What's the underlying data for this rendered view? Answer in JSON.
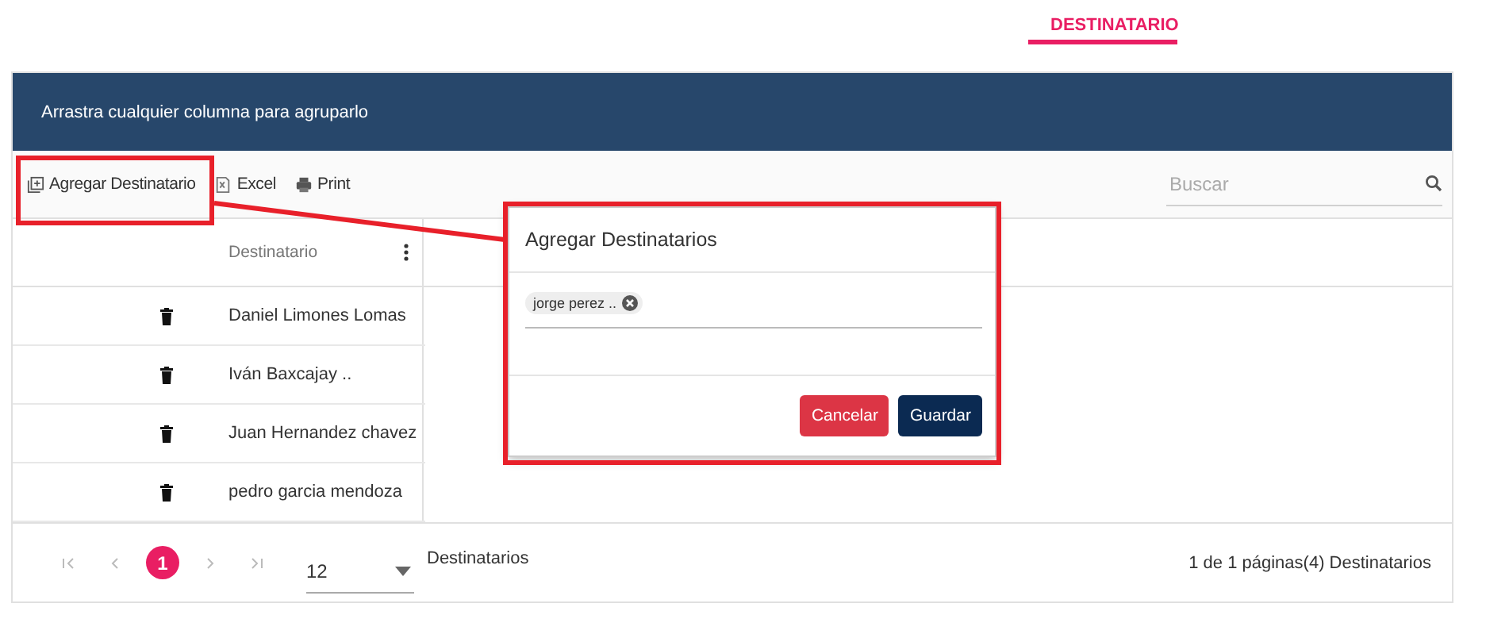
{
  "tabs": [
    {
      "label": "DESTINATARIO",
      "selected": true
    }
  ],
  "grid": {
    "group_panel": "Arrastra cualquier columna para agruparlo",
    "toolbar": [
      {
        "label": "Agregar Destinatario",
        "kind": "add"
      },
      {
        "label": "Excel",
        "kind": "excel"
      },
      {
        "label": "Print",
        "kind": "print"
      }
    ],
    "search": {
      "placeholder": "Buscar"
    },
    "columns": [
      {
        "label": "Destinatario"
      }
    ],
    "rows": [
      {
        "destinatario": "Daniel Limones Lomas"
      },
      {
        "destinatario": "Iván Baxcajay .."
      },
      {
        "destinatario": "Juan Hernandez chavez"
      },
      {
        "destinatario": "pedro garcia mendoza"
      }
    ],
    "pager": {
      "pages": [
        {
          "label": "1",
          "selected": true
        }
      ],
      "page_size": "12",
      "page_size_label": "Destinatarios",
      "info": "1 de 1 páginas(4) Destinatarios"
    }
  },
  "dialog": {
    "title": "Agregar Destinatarios",
    "chips": [
      {
        "label": "jorge perez .."
      }
    ],
    "buttons": [
      {
        "label": "Cancelar",
        "kind": "danger"
      },
      {
        "label": "Guardar",
        "kind": "primary"
      }
    ]
  }
}
